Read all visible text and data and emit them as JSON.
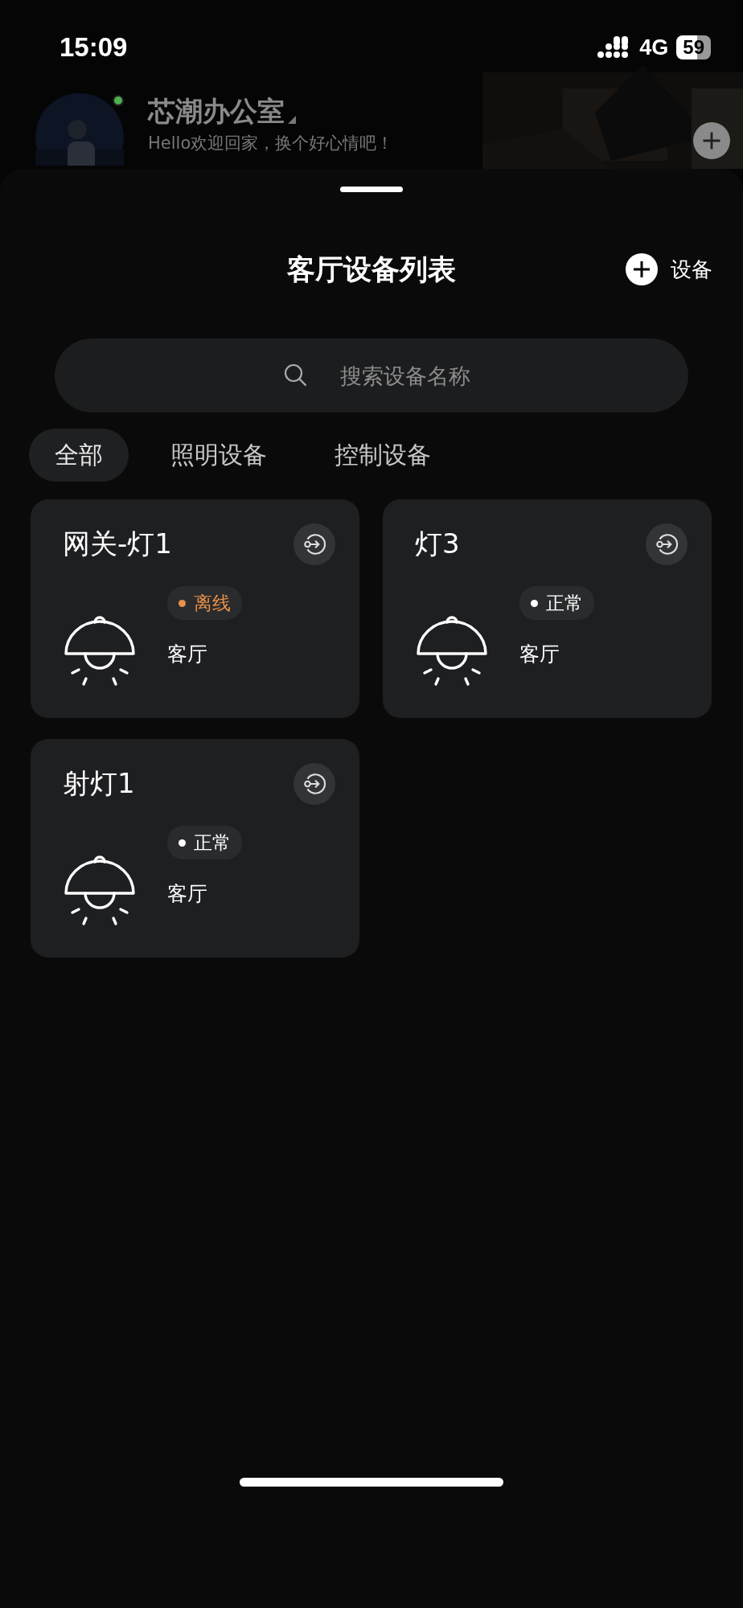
{
  "status_bar": {
    "time": "15:09",
    "network": "4G",
    "battery": "59"
  },
  "header": {
    "title": "芯潮办公室",
    "subtitle": "Hello欢迎回家，换个好心情吧！",
    "online": true
  },
  "sheet": {
    "title": "客厅设备列表",
    "add_label": "设备"
  },
  "search": {
    "placeholder": "搜索设备名称"
  },
  "tabs": [
    {
      "label": "全部",
      "selected": true
    },
    {
      "label": "照明设备",
      "selected": false
    },
    {
      "label": "控制设备",
      "selected": false
    }
  ],
  "devices": [
    {
      "name": "网关-灯1",
      "status": "离线",
      "kind": "offline",
      "room": "客厅"
    },
    {
      "name": "灯3",
      "status": "正常",
      "kind": "normal",
      "room": "客厅"
    },
    {
      "name": "射灯1",
      "status": "正常",
      "kind": "normal",
      "room": "客厅"
    }
  ]
}
